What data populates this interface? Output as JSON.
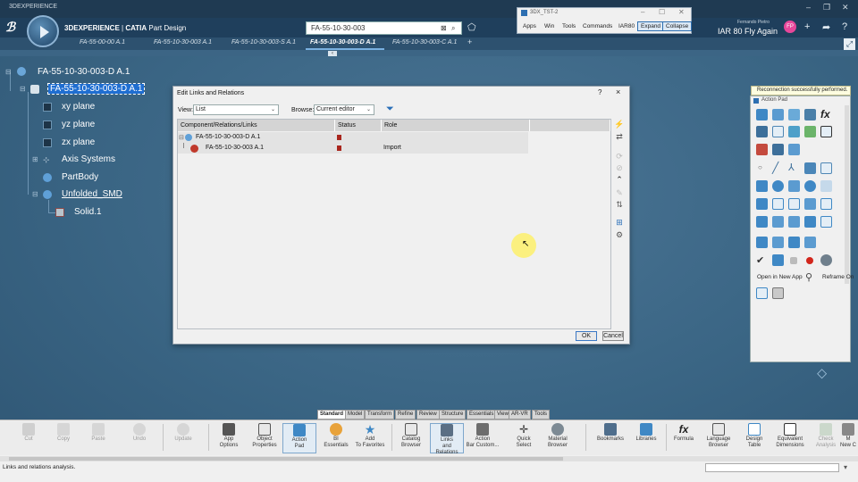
{
  "window": {
    "title": "3DEXPERIENCE"
  },
  "app": {
    "brand_prefix": "3DEXPERIENCE",
    "brand_app": "CATIA",
    "brand_module": "Part Design"
  },
  "search": {
    "value": "FA-55-10-30-003"
  },
  "user": {
    "name": "Fernando Pietro",
    "label": "IAR 80 Fly Again",
    "initials": "FP"
  },
  "tst_window": {
    "title": "3DX_TST-2",
    "menu": [
      "Apps",
      "Win",
      "Tools",
      "Commands",
      "IAR80"
    ],
    "buttons": [
      "Expand",
      "Collapse"
    ]
  },
  "tabs": [
    {
      "label": "FA-55-00-00 A.1",
      "active": false
    },
    {
      "label": "FA-55-10-30-003 A.1",
      "active": false
    },
    {
      "label": "FA-55-10-30-003-S A.1",
      "active": false
    },
    {
      "label": "FA-55-10-30-003-D A.1",
      "active": true
    },
    {
      "label": "FA-55-10-30-003-C A.1",
      "active": false
    },
    {
      "label": "+",
      "active": false
    }
  ],
  "tree": {
    "root": "FA-55-10-30-003-D A.1",
    "part": "FA-55-10-30-003-D A.1",
    "children": [
      "xy plane",
      "yz plane",
      "zx plane",
      "Axis Systems",
      "PartBody",
      "Unfolded_SMD",
      "Solid.1"
    ]
  },
  "dialog": {
    "title": "Edit Links and Relations",
    "help": "?",
    "close": "×",
    "view_label": "View:",
    "view_value": "List",
    "browse_label": "Browse:",
    "browse_value": "Current editor",
    "columns": [
      "Component/Relations/Links",
      "Status",
      "Role",
      ""
    ],
    "rows": [
      {
        "name": "FA-55-10-30-003-D A.1",
        "role": ""
      },
      {
        "name": "FA-55-10-30-003 A.1",
        "role": "Import"
      }
    ],
    "ok": "OK",
    "cancel": "Cancel"
  },
  "action_pad": {
    "notification": "Reconnection successfully performed.",
    "title": "Action Pad",
    "open_in_new_app": "Open in New App",
    "reframe_on": "Reframe On"
  },
  "section_tabs": [
    "Standard",
    "Model",
    "Transform",
    "Refine",
    "Review",
    "Structure",
    "Essentials",
    "View",
    "AR-VR",
    "Tools"
  ],
  "toolbar": [
    {
      "label": "Cut",
      "disabled": true
    },
    {
      "label": "Copy",
      "disabled": true
    },
    {
      "label": "Paste",
      "disabled": true
    },
    {
      "label": "Undo",
      "disabled": true
    },
    {
      "label": "Update",
      "disabled": true
    },
    {
      "label": "App\nOptions",
      "disabled": false
    },
    {
      "label": "Object\nProperties",
      "disabled": false
    },
    {
      "label": "Action\nPad",
      "disabled": false
    },
    {
      "label": "BI\nEssentials",
      "disabled": false
    },
    {
      "label": "Add\nTo Favorites",
      "disabled": false
    },
    {
      "label": "Catalog\nBrowser",
      "disabled": false
    },
    {
      "label": "Links\nand Relations",
      "disabled": false
    },
    {
      "label": "Action\nBar Custom...",
      "disabled": false
    },
    {
      "label": "Quick\nSelect",
      "disabled": false
    },
    {
      "label": "Material\nBrowser",
      "disabled": false
    },
    {
      "label": "Bookmarks",
      "disabled": false
    },
    {
      "label": "Libraries",
      "disabled": false
    },
    {
      "label": "Formula",
      "disabled": false
    },
    {
      "label": "Language\nBrowser",
      "disabled": false
    },
    {
      "label": "Design\nTable",
      "disabled": false
    },
    {
      "label": "Equivalent\nDimensions",
      "disabled": false
    },
    {
      "label": "Check\nAnalysis",
      "disabled": true
    },
    {
      "label": "M\nNew C",
      "disabled": false
    }
  ],
  "status": {
    "text": "Links and relations analysis."
  },
  "colors": {
    "viewport": "#3a6584",
    "selection": "#1f6ed1",
    "accent": "#2d6fb1",
    "status_red": "#a9261e"
  }
}
